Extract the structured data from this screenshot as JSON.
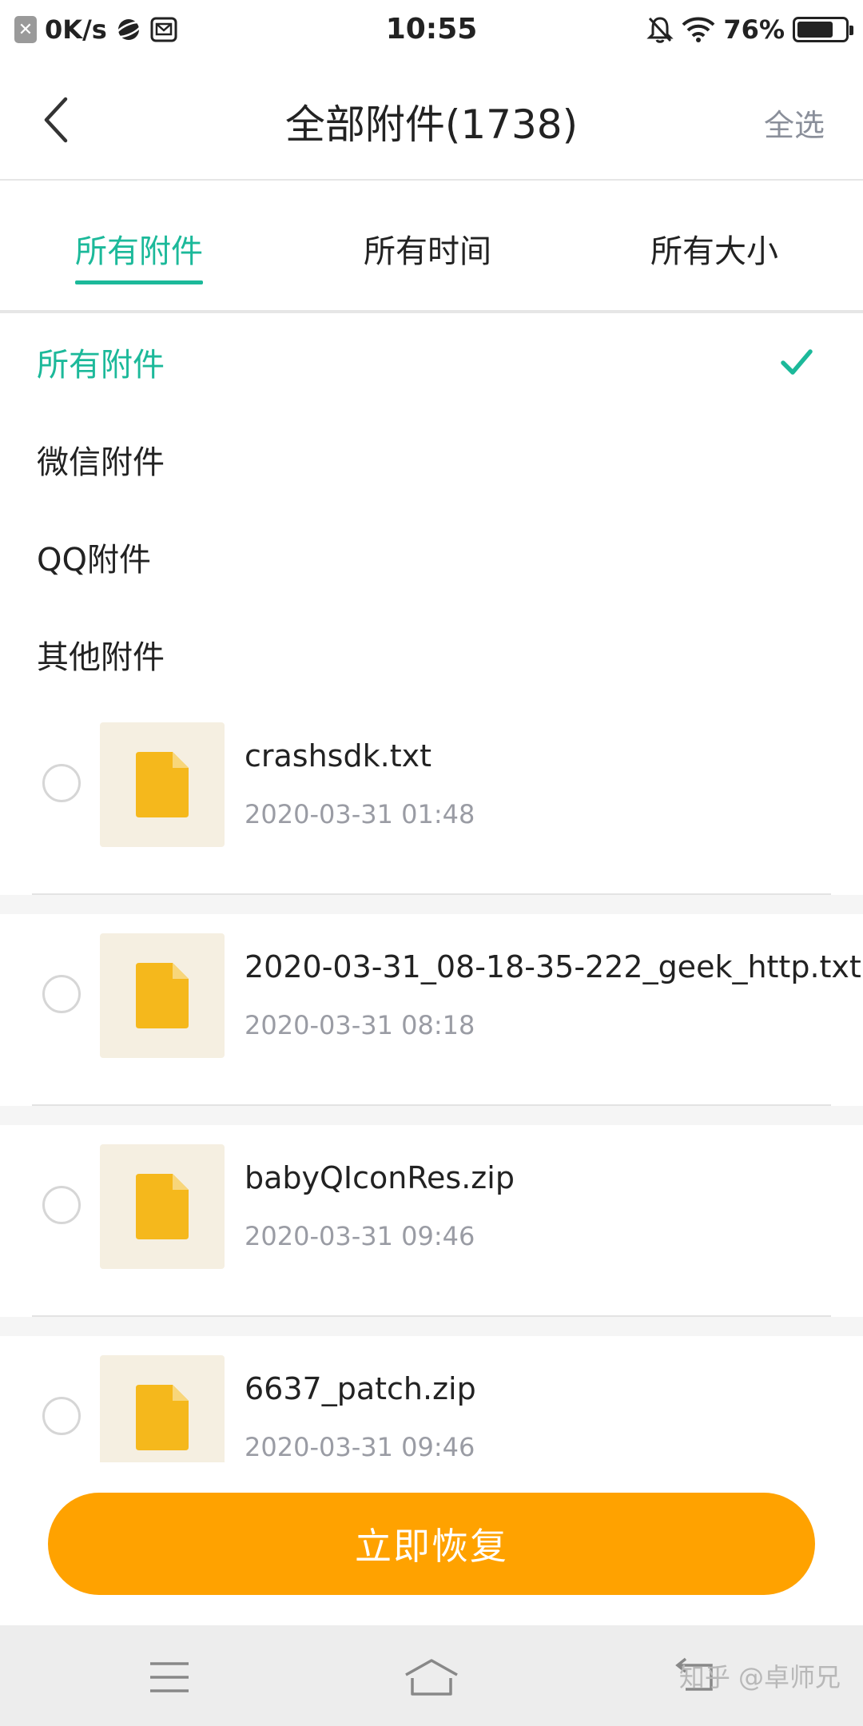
{
  "status_bar": {
    "net_speed": "0K/s",
    "time": "10:55",
    "battery_percent": "76%",
    "battery_level": 0.76
  },
  "header": {
    "title": "全部附件(1738)",
    "select_all": "全选"
  },
  "tabs": [
    {
      "label": "所有附件",
      "active": true
    },
    {
      "label": "所有时间",
      "active": false
    },
    {
      "label": "所有大小",
      "active": false
    }
  ],
  "filter_options": [
    {
      "label": "所有附件",
      "selected": true
    },
    {
      "label": "微信附件",
      "selected": false
    },
    {
      "label": "QQ附件",
      "selected": false
    },
    {
      "label": "其他附件",
      "selected": false
    }
  ],
  "files": [
    {
      "name": "crashsdk.txt",
      "date": "2020-03-31 01:48"
    },
    {
      "name": "2020-03-31_08-18-35-222_geek_http.txt",
      "date": "2020-03-31 08:18"
    },
    {
      "name": "babyQIconRes.zip",
      "date": "2020-03-31 09:46"
    },
    {
      "name": "6637_patch.zip",
      "date": "2020-03-31 09:46"
    }
  ],
  "restore_button": "立即恢复",
  "watermark": "知乎 @卓师兄",
  "colors": {
    "accent": "#1cb99a",
    "button": "#ffa200",
    "file_icon": "#f5b81c",
    "thumb_bg": "#f5efe1"
  }
}
